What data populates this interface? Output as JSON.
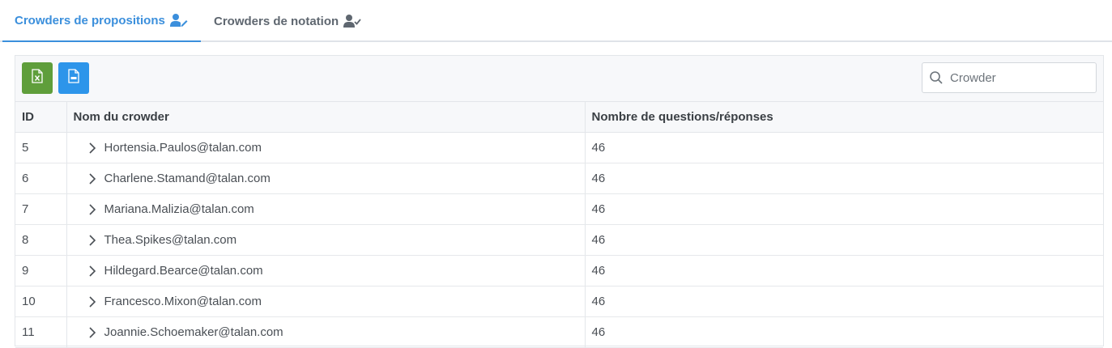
{
  "tabs": [
    {
      "label": "Crowders de propositions",
      "icon": "user-edit-icon",
      "active": true
    },
    {
      "label": "Crowders de notation",
      "icon": "user-check-icon",
      "active": false
    }
  ],
  "toolbar": {
    "excel_icon": "excel-file-icon",
    "csv_icon": "csv-file-icon",
    "search": {
      "placeholder": "Crowder",
      "value": ""
    }
  },
  "table": {
    "columns": [
      "ID",
      "Nom du crowder",
      "Nombre de questions/réponses"
    ],
    "rows": [
      {
        "id": "5",
        "name": "Hortensia.Paulos@talan.com",
        "count": "46"
      },
      {
        "id": "6",
        "name": "Charlene.Stamand@talan.com",
        "count": "46"
      },
      {
        "id": "7",
        "name": "Mariana.Malizia@talan.com",
        "count": "46"
      },
      {
        "id": "8",
        "name": "Thea.Spikes@talan.com",
        "count": "46"
      },
      {
        "id": "9",
        "name": "Hildegard.Bearce@talan.com",
        "count": "46"
      },
      {
        "id": "10",
        "name": "Francesco.Mixon@talan.com",
        "count": "46"
      },
      {
        "id": "11",
        "name": "Joannie.Schoemaker@talan.com",
        "count": "46"
      }
    ]
  },
  "colors": {
    "accent": "#3b8fdc",
    "excel_button": "#5f9e3b",
    "csv_button": "#2d95ea"
  }
}
